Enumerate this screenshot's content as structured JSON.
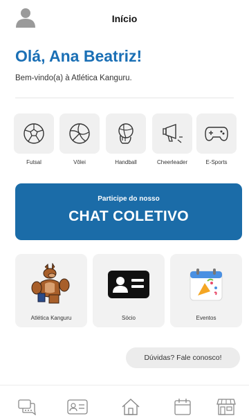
{
  "header": {
    "title": "Início"
  },
  "greeting": "Olá, Ana Beatriz!",
  "welcome": "Bem-vindo(a) à Atlética Kanguru.",
  "sports": [
    {
      "label": "Futsal",
      "icon": "soccer-ball-icon"
    },
    {
      "label": "Vôlei",
      "icon": "volleyball-icon"
    },
    {
      "label": "Handball",
      "icon": "handball-icon"
    },
    {
      "label": "Cheerleader",
      "icon": "cheerleader-megaphone-icon"
    },
    {
      "label": "E-Sports",
      "icon": "gamepad-icon"
    }
  ],
  "chat_banner": {
    "subtitle": "Participe do nosso",
    "title": "CHAT COLETIVO"
  },
  "cards": [
    {
      "label": "Atlética Kanguru",
      "icon": "kangaroo-mascot-icon"
    },
    {
      "label": "Sócio",
      "icon": "member-card-icon"
    },
    {
      "label": "Eventos",
      "icon": "calendar-party-icon"
    }
  ],
  "help_button": "Dúvidas? Fale conosco!",
  "bottom_nav": [
    {
      "icon": "chat-icon"
    },
    {
      "icon": "member-card-icon"
    },
    {
      "icon": "home-icon"
    },
    {
      "icon": "calendar-icon"
    },
    {
      "icon": "store-icon"
    }
  ],
  "colors": {
    "accent": "#1a6fb5",
    "banner": "#1b6ca8",
    "tile": "#f0f0f0"
  }
}
